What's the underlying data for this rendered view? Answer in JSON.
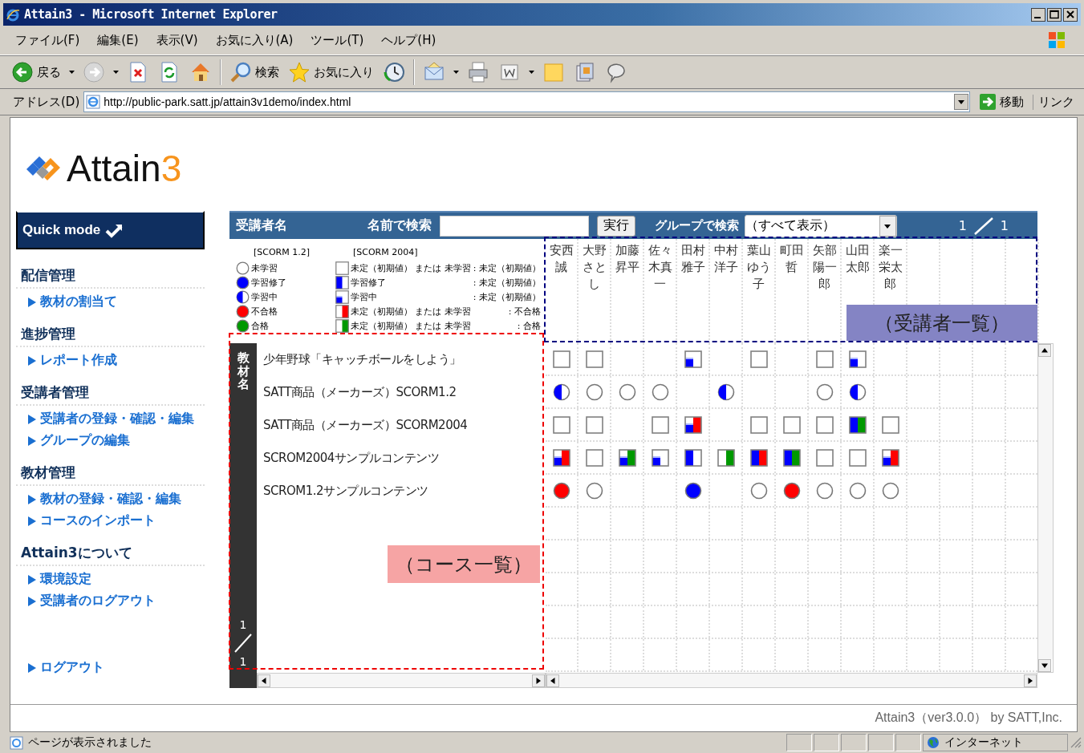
{
  "window": {
    "title": "Attain3 - Microsoft Internet Explorer"
  },
  "menu": [
    "ファイル(F)",
    "編集(E)",
    "表示(V)",
    "お気に入り(A)",
    "ツール(T)",
    "ヘルプ(H)"
  ],
  "toolbar": {
    "back_label": "戻る",
    "search_label": "検索",
    "favorites_label": "お気に入り"
  },
  "address_bar": {
    "label": "アドレス(D)",
    "url": "http://public-park.satt.jp/attain3v1demo/index.html",
    "go_label": "移動",
    "links_label": "リンク"
  },
  "logo": {
    "text": "Attain",
    "accent": "3"
  },
  "sidebar": {
    "quick_mode": "Quick mode",
    "sections": [
      {
        "title": "配信管理",
        "items": [
          "教材の割当て"
        ]
      },
      {
        "title": "進捗管理",
        "items": [
          "レポート作成"
        ]
      },
      {
        "title": "受講者管理",
        "items": [
          "受講者の登録・確認・編集",
          "グループの編集"
        ]
      },
      {
        "title": "教材管理",
        "items": [
          "教材の登録・確認・編集",
          "コースのインポート"
        ]
      },
      {
        "title": "Attain3について",
        "items": [
          "環境設定",
          "受講者のログアウト"
        ]
      }
    ],
    "logout": "ログアウト"
  },
  "panel": {
    "header": {
      "title": "受講者名",
      "name_search_label": "名前で検索",
      "run_button": "実行",
      "group_search_label": "グループで検索",
      "group_select": "（すべて表示）",
      "page": "1",
      "pages": "1"
    },
    "legend": {
      "scorm12_title": "[SCORM 1.2]",
      "scorm12": [
        {
          "kind": "unattempted",
          "label": "未学習"
        },
        {
          "kind": "completed",
          "label": "学習修了"
        },
        {
          "kind": "incomplete",
          "label": "学習中"
        },
        {
          "kind": "failed",
          "label": "不合格"
        },
        {
          "kind": "passed",
          "label": "合格"
        }
      ],
      "scorm2004_title": "[SCORM 2004]",
      "scorm2004": [
        {
          "completed": false,
          "incomplete": false,
          "failed": false,
          "passed": false,
          "label": "未定（初期値） または 未学習",
          "result": ": 未定（初期値）"
        },
        {
          "completed": true,
          "incomplete": false,
          "failed": false,
          "passed": false,
          "label": "学習修了",
          "result": ": 未定（初期値）"
        },
        {
          "completed": false,
          "incomplete": true,
          "failed": false,
          "passed": false,
          "label": "学習中",
          "result": ": 未定（初期値）"
        },
        {
          "completed": false,
          "incomplete": false,
          "failed": true,
          "passed": false,
          "label": "未定（初期値） または 未学習",
          "result": ": 不合格"
        },
        {
          "completed": false,
          "incomplete": false,
          "failed": false,
          "passed": true,
          "label": "未定（初期値） または 未学習",
          "result": ": 合格"
        }
      ]
    },
    "students": [
      "安西誠",
      "大野さとし",
      "加藤昇平",
      "佐々木真一",
      "田村雅子",
      "中村洋子",
      "葉山ゆう子",
      "町田哲",
      "矢部陽一郎",
      "山田太郎",
      "楽一栄太郎"
    ],
    "course_column_label": "教材名",
    "course_page": "1",
    "course_pages": "1",
    "courses": [
      {
        "title": "少年野球「キャッチボールをしよう」",
        "cells": [
          {
            "kind": "box",
            "completed": false,
            "incomplete": false,
            "failed": false,
            "passed": false
          },
          {
            "kind": "box",
            "completed": false,
            "incomplete": false,
            "failed": false,
            "passed": false
          },
          {
            "kind": "empty"
          },
          {
            "kind": "empty"
          },
          {
            "kind": "box",
            "completed": false,
            "incomplete": true,
            "failed": false,
            "passed": false
          },
          {
            "kind": "empty"
          },
          {
            "kind": "box",
            "completed": false,
            "incomplete": false,
            "failed": false,
            "passed": false
          },
          {
            "kind": "empty"
          },
          {
            "kind": "box",
            "completed": false,
            "incomplete": false,
            "failed": false,
            "passed": false
          },
          {
            "kind": "box",
            "completed": false,
            "incomplete": true,
            "failed": false,
            "passed": false
          },
          {
            "kind": "empty"
          }
        ]
      },
      {
        "title": "SATT商品（メーカーズ）SCORM1.2",
        "cells": [
          {
            "kind": "incomplete"
          },
          {
            "kind": "unattempted"
          },
          {
            "kind": "unattempted"
          },
          {
            "kind": "unattempted"
          },
          {
            "kind": "empty"
          },
          {
            "kind": "incomplete"
          },
          {
            "kind": "empty"
          },
          {
            "kind": "empty"
          },
          {
            "kind": "unattempted"
          },
          {
            "kind": "incomplete"
          },
          {
            "kind": "empty"
          }
        ]
      },
      {
        "title": "SATT商品（メーカーズ）SCORM2004",
        "cells": [
          {
            "kind": "box",
            "completed": false,
            "incomplete": false,
            "failed": false,
            "passed": false
          },
          {
            "kind": "box",
            "completed": false,
            "incomplete": false,
            "failed": false,
            "passed": false
          },
          {
            "kind": "empty"
          },
          {
            "kind": "box",
            "completed": false,
            "incomplete": false,
            "failed": false,
            "passed": false
          },
          {
            "kind": "box",
            "completed": false,
            "incomplete": true,
            "failed": true,
            "passed": false
          },
          {
            "kind": "empty"
          },
          {
            "kind": "box",
            "completed": false,
            "incomplete": false,
            "failed": false,
            "passed": false
          },
          {
            "kind": "box",
            "completed": false,
            "incomplete": false,
            "failed": false,
            "passed": false
          },
          {
            "kind": "box",
            "completed": false,
            "incomplete": false,
            "failed": false,
            "passed": false
          },
          {
            "kind": "box",
            "completed": true,
            "incomplete": false,
            "failed": false,
            "passed": true
          },
          {
            "kind": "box",
            "completed": false,
            "incomplete": false,
            "failed": false,
            "passed": false
          }
        ]
      },
      {
        "title": "SCROM2004サンプルコンテンツ",
        "cells": [
          {
            "kind": "box",
            "completed": false,
            "incomplete": true,
            "failed": true,
            "passed": false
          },
          {
            "kind": "box",
            "completed": false,
            "incomplete": false,
            "failed": false,
            "passed": false
          },
          {
            "kind": "box",
            "completed": false,
            "incomplete": true,
            "failed": false,
            "passed": true
          },
          {
            "kind": "box",
            "completed": false,
            "incomplete": true,
            "failed": false,
            "passed": false
          },
          {
            "kind": "box",
            "completed": true,
            "incomplete": false,
            "failed": false,
            "passed": false
          },
          {
            "kind": "box",
            "completed": false,
            "incomplete": false,
            "failed": false,
            "passed": true
          },
          {
            "kind": "box",
            "completed": true,
            "incomplete": false,
            "failed": true,
            "passed": false
          },
          {
            "kind": "box",
            "completed": true,
            "incomplete": false,
            "failed": false,
            "passed": true
          },
          {
            "kind": "box",
            "completed": false,
            "incomplete": false,
            "failed": false,
            "passed": false
          },
          {
            "kind": "box",
            "completed": false,
            "incomplete": false,
            "failed": false,
            "passed": false
          },
          {
            "kind": "box",
            "completed": false,
            "incomplete": true,
            "failed": true,
            "passed": false
          }
        ]
      },
      {
        "title": "SCROM1.2サンプルコンテンツ",
        "cells": [
          {
            "kind": "failed"
          },
          {
            "kind": "unattempted"
          },
          {
            "kind": "empty"
          },
          {
            "kind": "empty"
          },
          {
            "kind": "completed"
          },
          {
            "kind": "empty"
          },
          {
            "kind": "unattempted"
          },
          {
            "kind": "failed"
          },
          {
            "kind": "unattempted"
          },
          {
            "kind": "unattempted"
          },
          {
            "kind": "unattempted"
          }
        ]
      }
    ]
  },
  "annotations": [
    {
      "kind": "courses",
      "text": "（コース一覧）"
    },
    {
      "kind": "students",
      "text": "（受講者一覧）"
    }
  ],
  "footer": "Attain3（ver3.0.0） by SATT,Inc.",
  "status_bar": {
    "text": "ページが表示されました",
    "zone": "インターネット"
  }
}
